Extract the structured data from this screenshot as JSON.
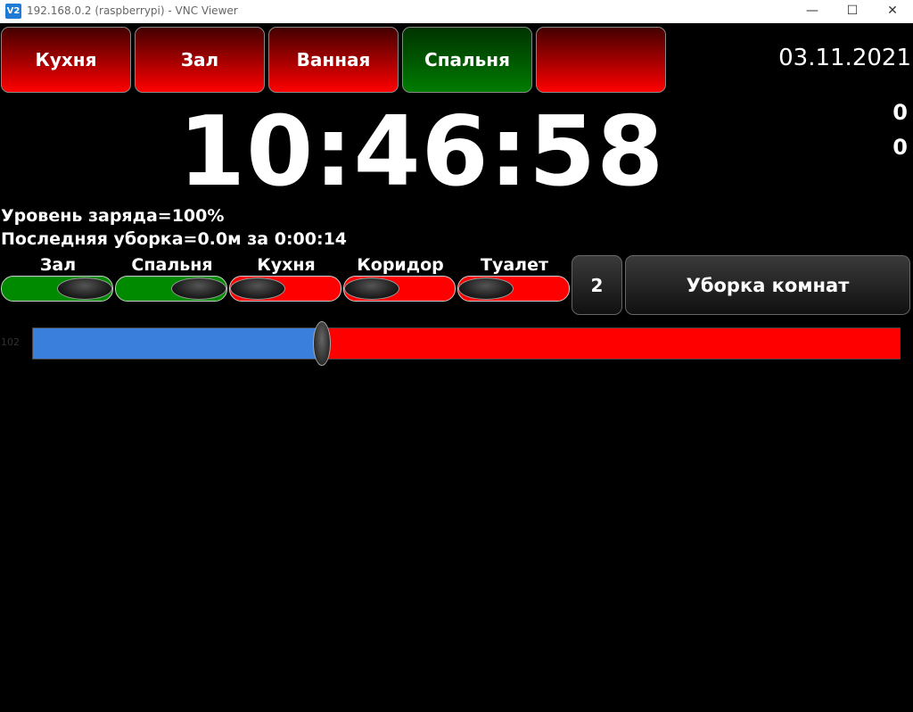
{
  "window": {
    "app_icon": "V2",
    "title": "192.168.0.2 (raspberrypi) - VNC Viewer",
    "minimize": "—",
    "maximize": "☐",
    "close": "✕"
  },
  "rooms": [
    {
      "label": "Кухня",
      "state": "red"
    },
    {
      "label": "Зал",
      "state": "red"
    },
    {
      "label": "Ванная",
      "state": "red"
    },
    {
      "label": "Спальня",
      "state": "green"
    },
    {
      "label": "",
      "state": "red"
    }
  ],
  "date": "03.11.2021",
  "counters": [
    "0",
    "0"
  ],
  "clock": "10:46:58",
  "battery": "Уровень заряда=100%",
  "last_cleaning": "Последняя уборка=0.0м за 0:00:14",
  "zones": [
    {
      "label": "Зал",
      "on": true
    },
    {
      "label": "Спальня",
      "on": true
    },
    {
      "label": "Кухня",
      "on": false
    },
    {
      "label": "Коридор",
      "on": false
    },
    {
      "label": "Туалет",
      "on": false
    }
  ],
  "passes_button": "2",
  "clean_button": "Уборка комнат",
  "slider": {
    "label": "102",
    "fraction": 0.333
  },
  "colors": {
    "on": "#008a00",
    "off": "#ff0000",
    "slider_fill": "#3a7fdc"
  }
}
